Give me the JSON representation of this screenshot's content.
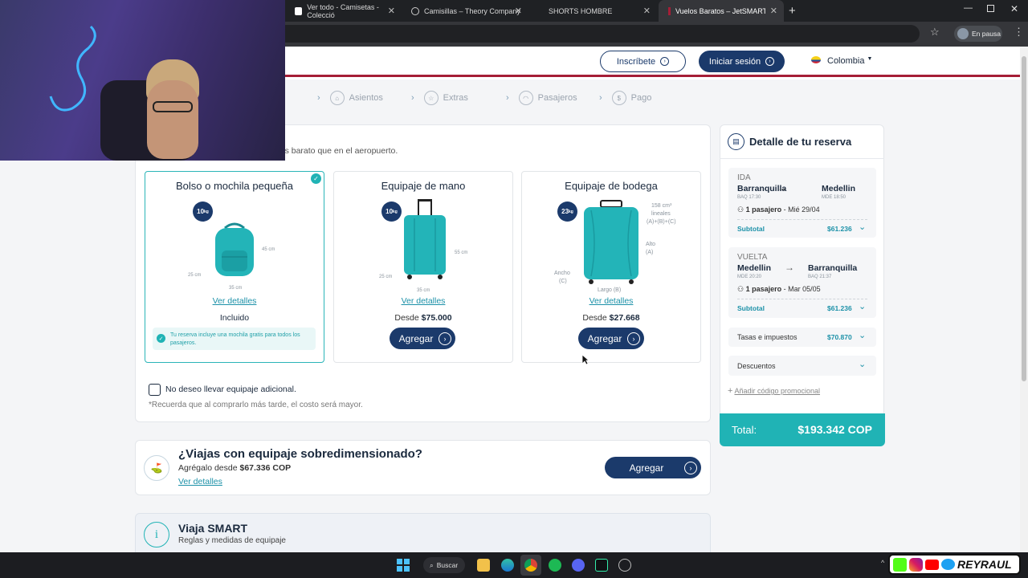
{
  "browser": {
    "tabs": [
      {
        "title": "Ver todo - Camisetas - Colecció"
      },
      {
        "title": "Camisillas – Theory Company"
      },
      {
        "title": "SHORTS HOMBRE"
      },
      {
        "title": "Vuelos Baratos – JetSMART Av"
      }
    ],
    "new_tab": "+",
    "profile_status": "En pausa"
  },
  "header": {
    "signup": "Inscríbete",
    "login": "Iniciar sesión",
    "country": "Colombia"
  },
  "steps": [
    {
      "label": "Asientos",
      "icon": "seat-icon"
    },
    {
      "label": "Extras",
      "icon": "star-icon"
    },
    {
      "label": "Pasajeros",
      "icon": "person-icon"
    },
    {
      "label": "Pago",
      "icon": "dollar-icon"
    }
  ],
  "baggage": {
    "intro": "mas barato que en el aeropuerto.",
    "options": [
      {
        "title": "Bolso o mochila pequeña",
        "weight": "10",
        "unit": "kg",
        "details": "Ver detalles",
        "status": "Incluido",
        "note": "Tu reserva incluye una mochila gratis para todos los pasajeros.",
        "dims": [
          "25 cm",
          "45 cm",
          "35 cm"
        ]
      },
      {
        "title": "Equipaje de mano",
        "weight": "10",
        "unit": "kg",
        "details": "Ver detalles",
        "price_prefix": "Desde",
        "price": "$75.000",
        "button": "Agregar",
        "dims": [
          "25 cm",
          "55 cm",
          "35 cm"
        ]
      },
      {
        "title": "Equipaje de bodega",
        "weight": "23",
        "unit": "kg",
        "details": "Ver detalles",
        "price_prefix": "Desde",
        "price": "$27.668",
        "button": "Agregar",
        "dims": [
          "158 cm³",
          "lineales",
          "(A)+(B)+(C)",
          "Alto",
          "(A)",
          "Ancho",
          "(C)",
          "Largo (B)"
        ]
      }
    ],
    "no_extra": "No deseo llevar equipaje adicional.",
    "reminder": "*Recuerda que al comprarlo más tarde, el costo será mayor."
  },
  "oversize": {
    "title": "¿Viajas con equipaje sobredimensionado?",
    "subtitle_prefix": "Agrégalo desde",
    "price": "$67.336 COP",
    "details": "Ver detalles",
    "button": "Agregar"
  },
  "smart": {
    "title": "Viaja SMART",
    "subtitle": "Reglas y medidas de equipaje"
  },
  "summary": {
    "title": "Detalle de tu reserva",
    "outbound": {
      "label": "IDA",
      "from": "Barranquilla",
      "to": "Medellin",
      "from_code": "BAQ 17:30",
      "to_code": "MDE 18:50",
      "pax": "1 pasajero",
      "date": "Mié 29/04",
      "subtotal_label": "Subtotal",
      "subtotal": "$61.236"
    },
    "return": {
      "label": "VUELTA",
      "from": "Medellin",
      "to": "Barranquilla",
      "from_code": "MDE 20:20",
      "to_code": "BAQ 21:37",
      "pax": "1 pasajero",
      "date": "Mar 05/05",
      "subtotal_label": "Subtotal",
      "subtotal": "$61.236"
    },
    "taxes_label": "Tasas e impuestos",
    "taxes": "$70.870",
    "discounts_label": "Descuentos",
    "promo": "Añadir código promocional",
    "total_label": "Total:",
    "total": "$193.342 COP"
  },
  "taskbar": {
    "search": "Buscar"
  },
  "overlay": {
    "channel": "REYRAUL"
  },
  "colors": {
    "navy": "#1b3a6b",
    "teal": "#20b3b5",
    "red": "#a51e36"
  }
}
